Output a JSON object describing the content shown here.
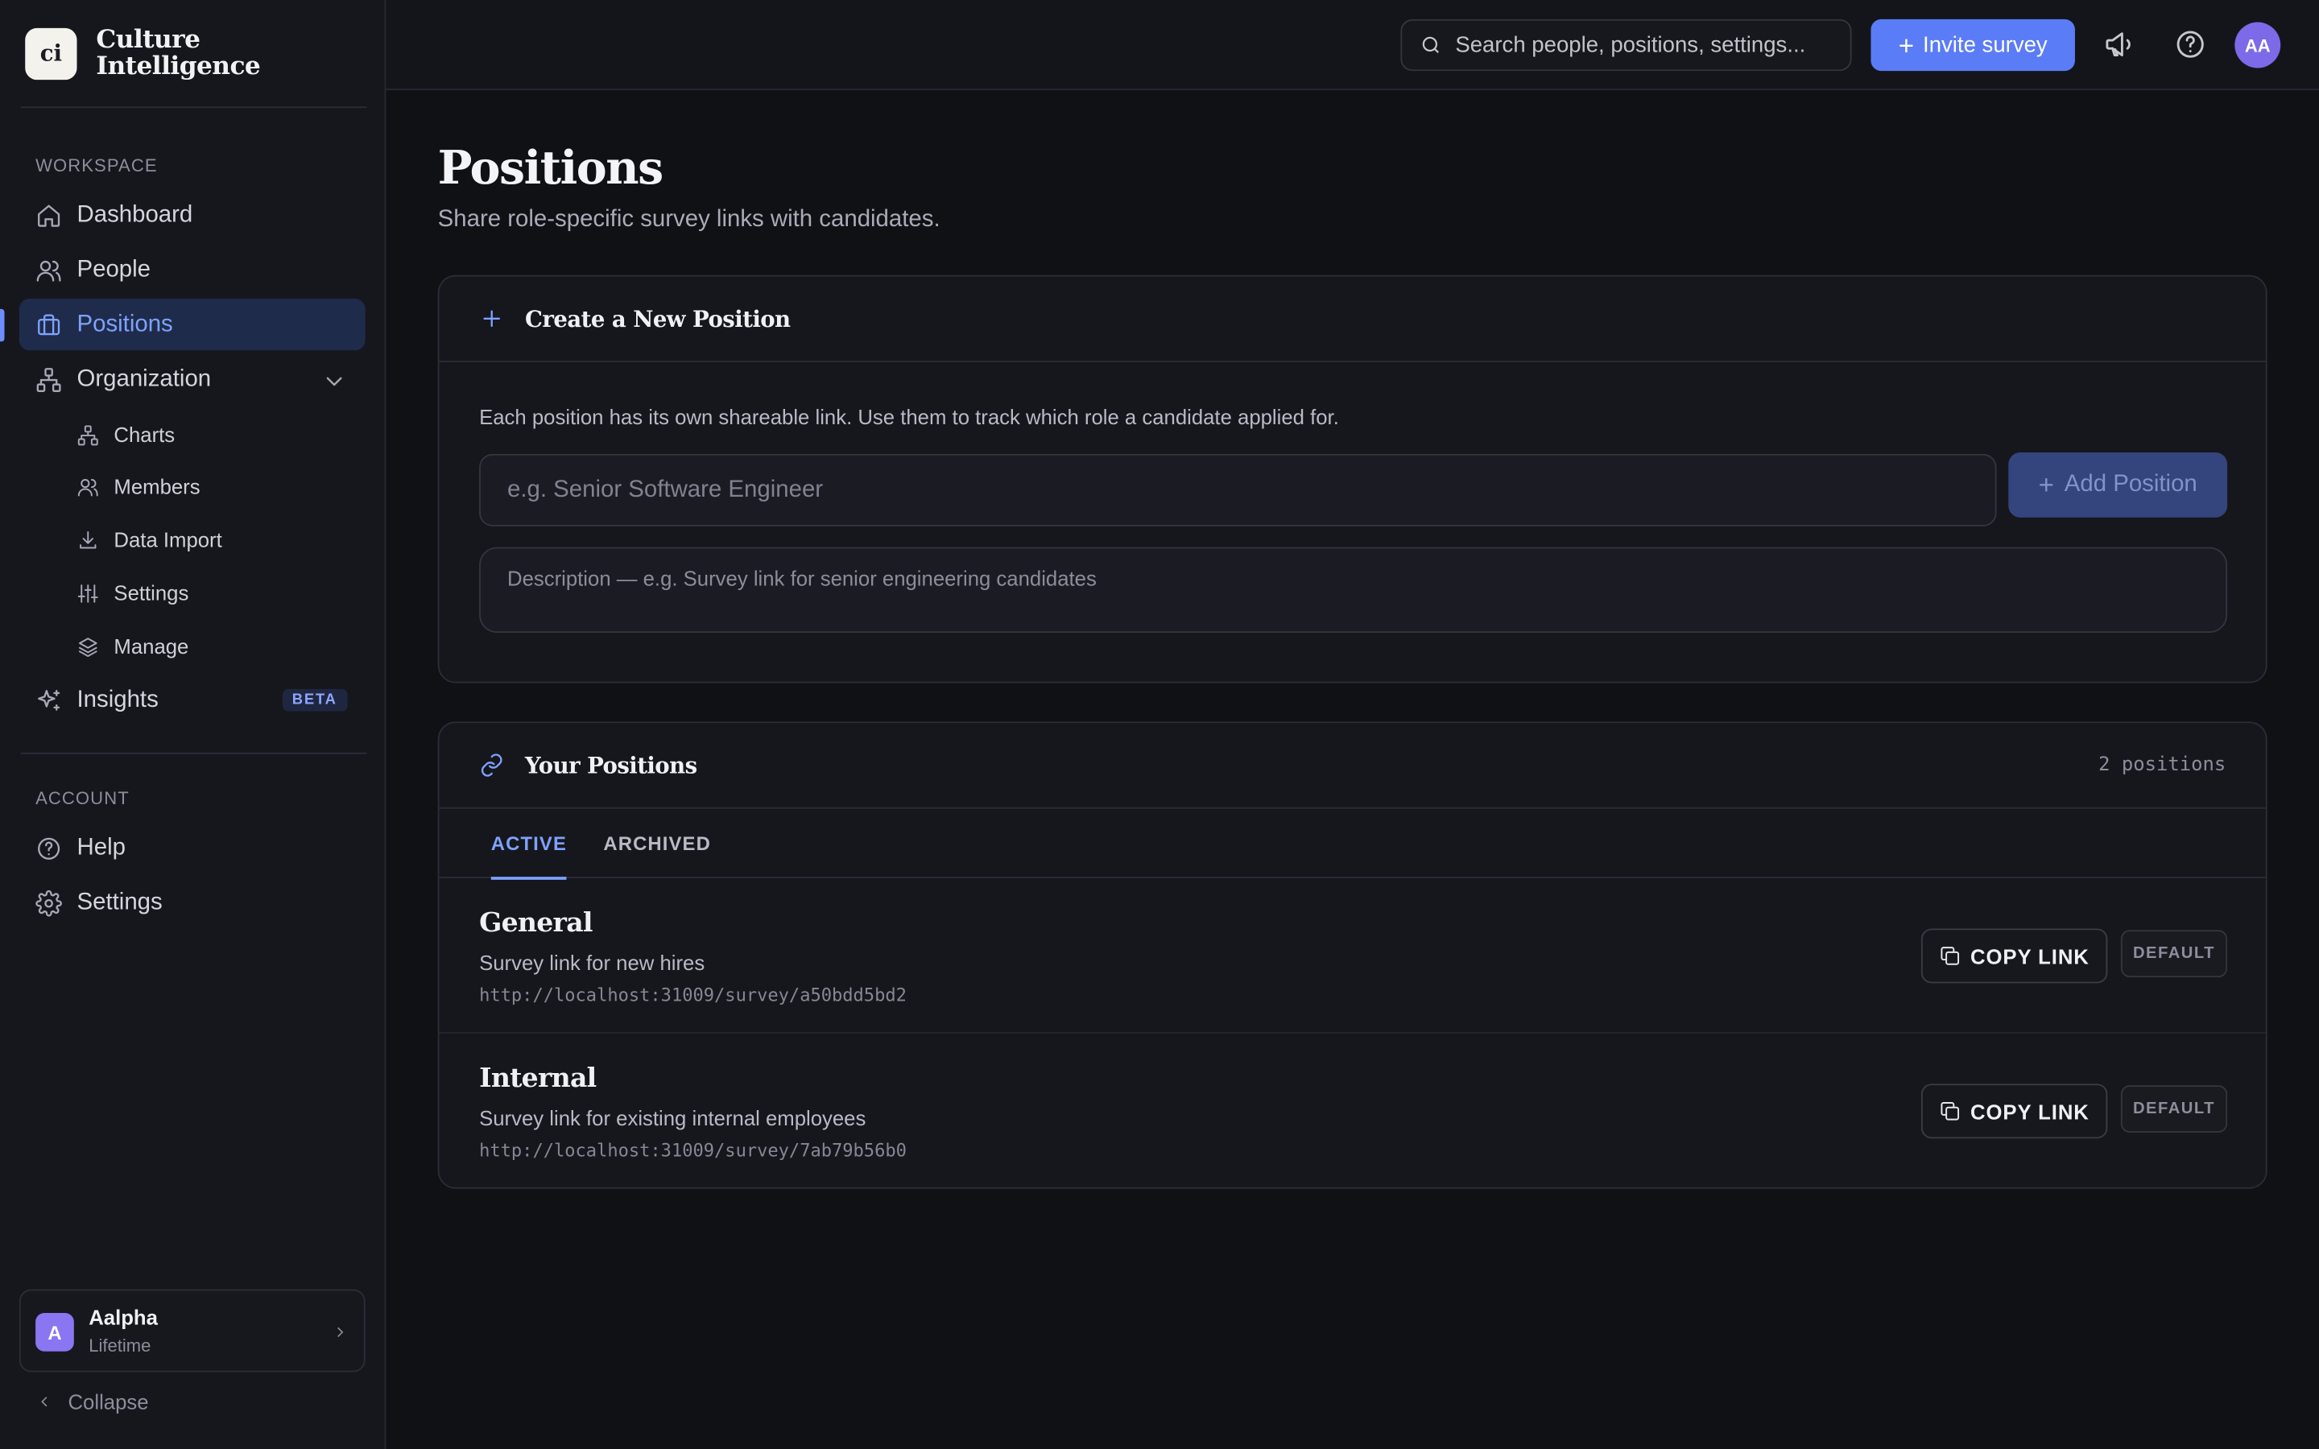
{
  "brand": {
    "logo_text": "ci",
    "name_line1": "Culture",
    "name_line2": "Intelligence"
  },
  "sidebar": {
    "workspace_label": "WORKSPACE",
    "items": [
      {
        "label": "Dashboard",
        "icon": "home-icon"
      },
      {
        "label": "People",
        "icon": "users-icon"
      },
      {
        "label": "Positions",
        "icon": "briefcase-icon",
        "active": true
      },
      {
        "label": "Organization",
        "icon": "org-chart-icon",
        "expanded": true
      }
    ],
    "org_subitems": [
      {
        "label": "Charts",
        "icon": "org-chart-icon"
      },
      {
        "label": "Members",
        "icon": "users-icon"
      },
      {
        "label": "Data Import",
        "icon": "download-icon"
      },
      {
        "label": "Settings",
        "icon": "sliders-icon"
      },
      {
        "label": "Manage",
        "icon": "layers-icon"
      }
    ],
    "insights": {
      "label": "Insights",
      "badge": "BETA",
      "icon": "sparkles-icon"
    },
    "account_label": "ACCOUNT",
    "account_items": [
      {
        "label": "Help",
        "icon": "help-circle-icon"
      },
      {
        "label": "Settings",
        "icon": "gear-icon"
      }
    ],
    "account_card": {
      "avatar": "A",
      "name": "Aalpha",
      "plan": "Lifetime"
    },
    "collapse_label": "Collapse"
  },
  "topbar": {
    "search_placeholder": "Search people, positions, settings...",
    "invite_label": "Invite survey",
    "avatar_initials": "AA"
  },
  "page": {
    "title": "Positions",
    "subtitle": "Share role-specific survey links with candidates."
  },
  "create_card": {
    "title": "Create a New Position",
    "help_text": "Each position has its own shareable link. Use them to track which role a candidate applied for.",
    "name_placeholder": "e.g. Senior Software Engineer",
    "add_label": "Add Position",
    "desc_placeholder": "Description — e.g. Survey link for senior engineering candidates"
  },
  "positions_card": {
    "title": "Your Positions",
    "count": "2 positions",
    "tabs": [
      {
        "label": "ACTIVE",
        "active": true
      },
      {
        "label": "ARCHIVED"
      }
    ],
    "rows": [
      {
        "title": "General",
        "description": "Survey link for new hires",
        "url": "http://localhost:31009/survey/a50bdd5bd2",
        "copy_label": "COPY LINK",
        "badge": "DEFAULT"
      },
      {
        "title": "Internal",
        "description": "Survey link for existing internal employees",
        "url": "http://localhost:31009/survey/7ab79b56b0",
        "copy_label": "COPY LINK",
        "badge": "DEFAULT"
      }
    ]
  },
  "colors": {
    "accent": "#5b7cf7",
    "active_text": "#7ea2ff",
    "background": "#101115"
  }
}
